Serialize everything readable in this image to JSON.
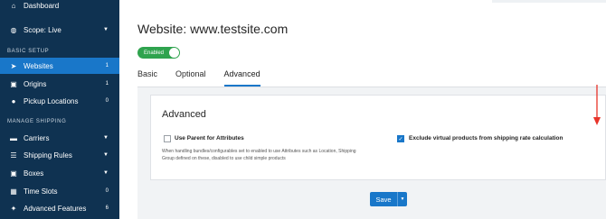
{
  "sidebar": {
    "dashboard": "Dashboard",
    "scope": "Scope: Live",
    "section_basic": "BASIC SETUP",
    "websites": {
      "label": "Websites",
      "count": "1"
    },
    "origins": {
      "label": "Origins",
      "count": "1"
    },
    "pickup": {
      "label": "Pickup Locations",
      "count": "0"
    },
    "section_manage": "MANAGE SHIPPING",
    "carriers": "Carriers",
    "shipping_rules": "Shipping Rules",
    "boxes": "Boxes",
    "time_slots": {
      "label": "Time Slots",
      "count": "0"
    },
    "advanced_features": {
      "label": "Advanced Features",
      "count": "6"
    }
  },
  "header": {
    "title": "Website: www.testsite.com",
    "toggle_label": "Enabled"
  },
  "tabs": [
    "Basic",
    "Optional",
    "Advanced"
  ],
  "card": {
    "title": "Advanced",
    "option1_label": "Use Parent for Attributes",
    "option1_help": "When handling bundles/configurables set to enabled to use Attributes such as Location, Shipping Group defined on these, disabled to use child simple products",
    "option2_label": "Exclude virtual products from shipping rate calculation"
  },
  "footer": {
    "save_label": "Save"
  },
  "colors": {
    "sidebar": "#0f3251",
    "accent": "#1977c9",
    "toggle": "#2fa34e",
    "arrow": "#e8342a"
  }
}
